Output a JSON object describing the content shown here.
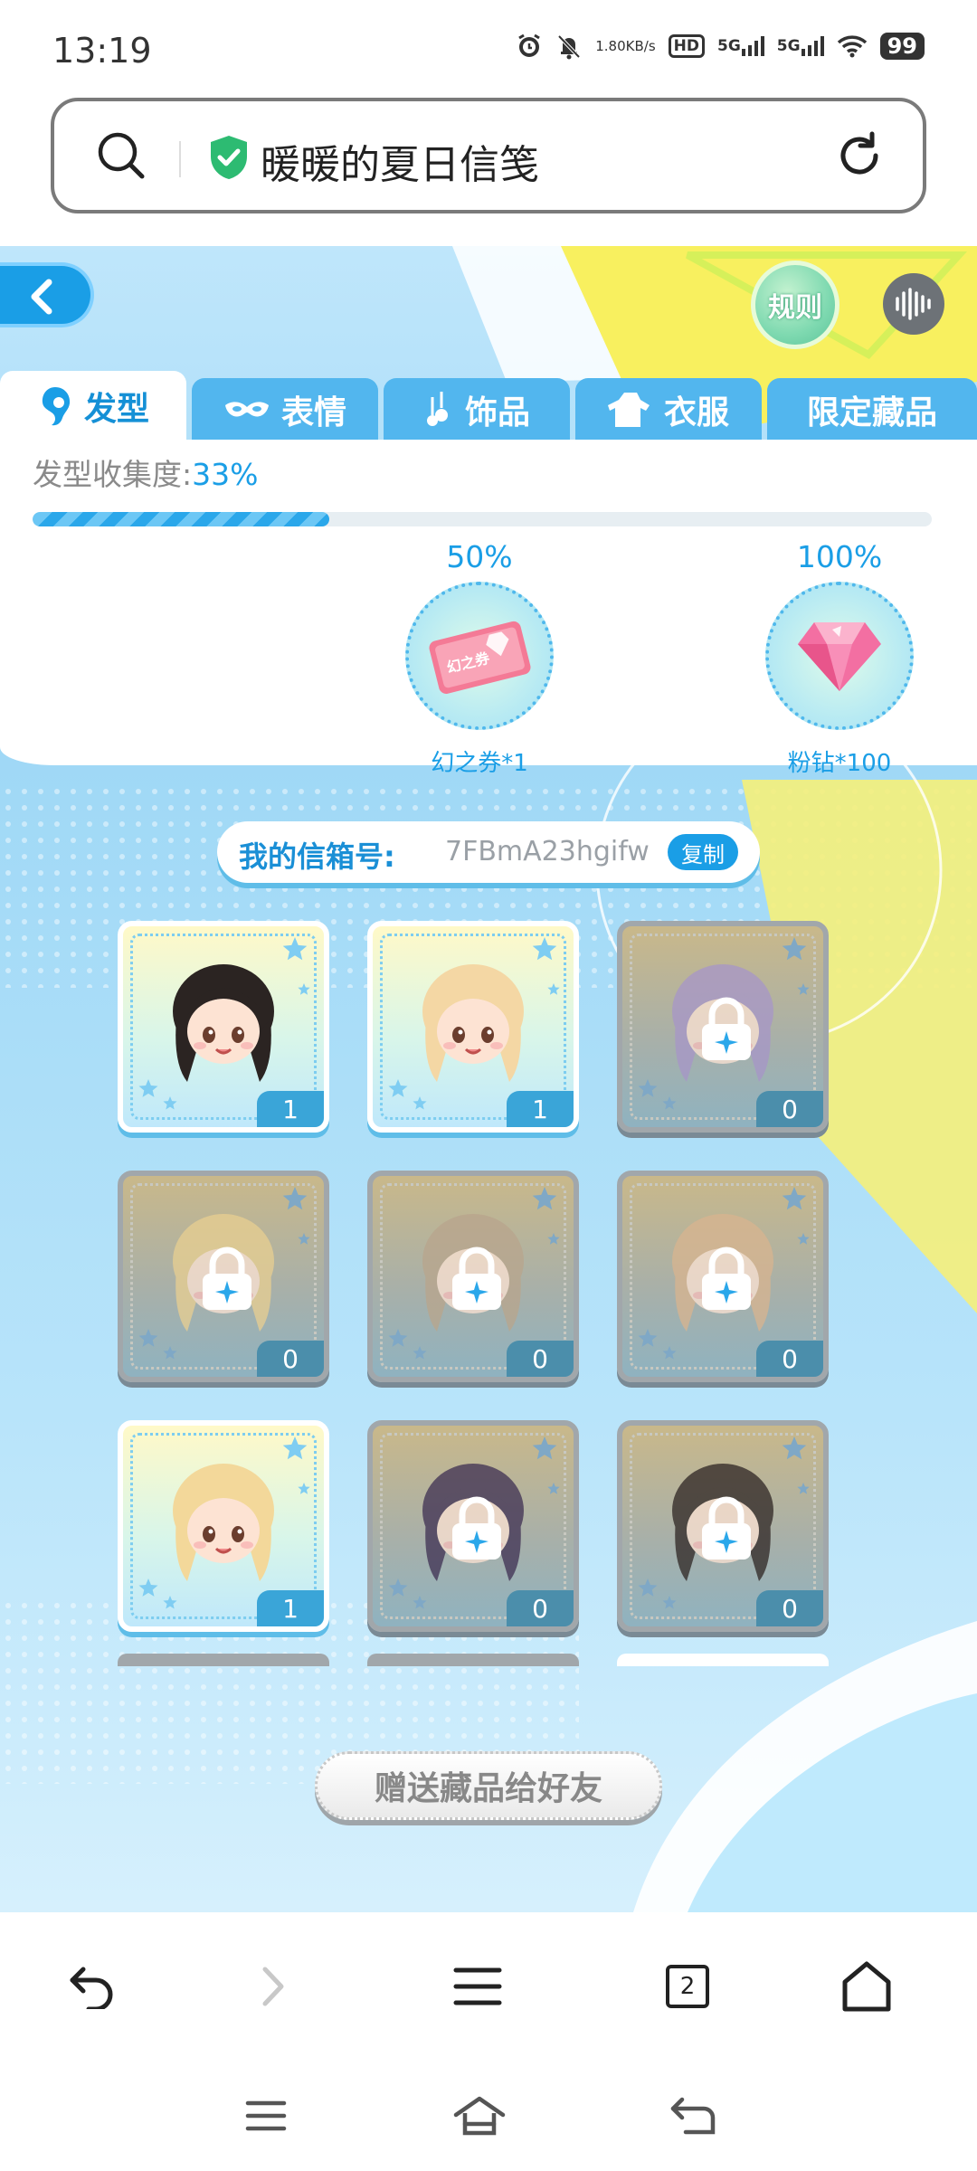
{
  "status_bar": {
    "time": "13:19",
    "net_speed_value": "1.80",
    "net_speed_unit": "KB/s",
    "hd_label": "HD",
    "signal1": "5G",
    "signal2": "5G",
    "battery": "99"
  },
  "address_bar": {
    "title": "暖暖的夏日信笺",
    "icons": [
      "search-icon",
      "shield-check-icon",
      "reload-icon"
    ]
  },
  "game": {
    "rule_button": "规则",
    "tabs": [
      {
        "label": "发型",
        "icon": "hair-icon",
        "active": true
      },
      {
        "label": "表情",
        "icon": "mask-icon",
        "active": false
      },
      {
        "label": "饰品",
        "icon": "accessory-icon",
        "active": false
      },
      {
        "label": "衣服",
        "icon": "clothes-icon",
        "active": false
      },
      {
        "label": "限定藏品",
        "icon": "",
        "active": false
      }
    ],
    "collection": {
      "label": "发型收集度:",
      "percent_text": "33%",
      "progress": 0.33
    },
    "milestones": [
      {
        "percent": "50%",
        "reward_label": "幻之券*1",
        "reward_icon": "ticket-icon",
        "ticket_text": "幻之券"
      },
      {
        "percent": "100%",
        "reward_label": "粉钻*100",
        "reward_icon": "pink-diamond-icon"
      }
    ],
    "mailbox": {
      "label": "我的信箱号:",
      "id": "7FBmA23hgifw",
      "copy_label": "复制"
    },
    "items": [
      {
        "count": "1",
        "owned": true,
        "hair": "#2b2422"
      },
      {
        "count": "1",
        "owned": true,
        "hair": "#f4d7a4"
      },
      {
        "count": "0",
        "owned": false,
        "hair": "#a796c8"
      },
      {
        "count": "0",
        "owned": false,
        "hair": "#e9cf91"
      },
      {
        "count": "0",
        "owned": false,
        "hair": "#b9a58c"
      },
      {
        "count": "0",
        "owned": false,
        "hair": "#d9b48f"
      },
      {
        "count": "1",
        "owned": true,
        "hair": "#f3d89a"
      },
      {
        "count": "0",
        "owned": false,
        "hair": "#3e2f52"
      },
      {
        "count": "0",
        "owned": false,
        "hair": "#2e2523"
      }
    ],
    "gift_button": "赠送藏品给好友"
  },
  "browser_nav": {
    "tab_count": "2",
    "icons": [
      "back-icon",
      "forward-icon",
      "menu-icon",
      "tabs-icon",
      "home-icon"
    ]
  },
  "system_nav": {
    "icons": [
      "recents-icon",
      "home-icon",
      "back-icon"
    ]
  },
  "colors": {
    "accent": "#1a9ee6",
    "tab_inactive": "#52b6ee",
    "locked_tile": "#a1a7ab"
  }
}
